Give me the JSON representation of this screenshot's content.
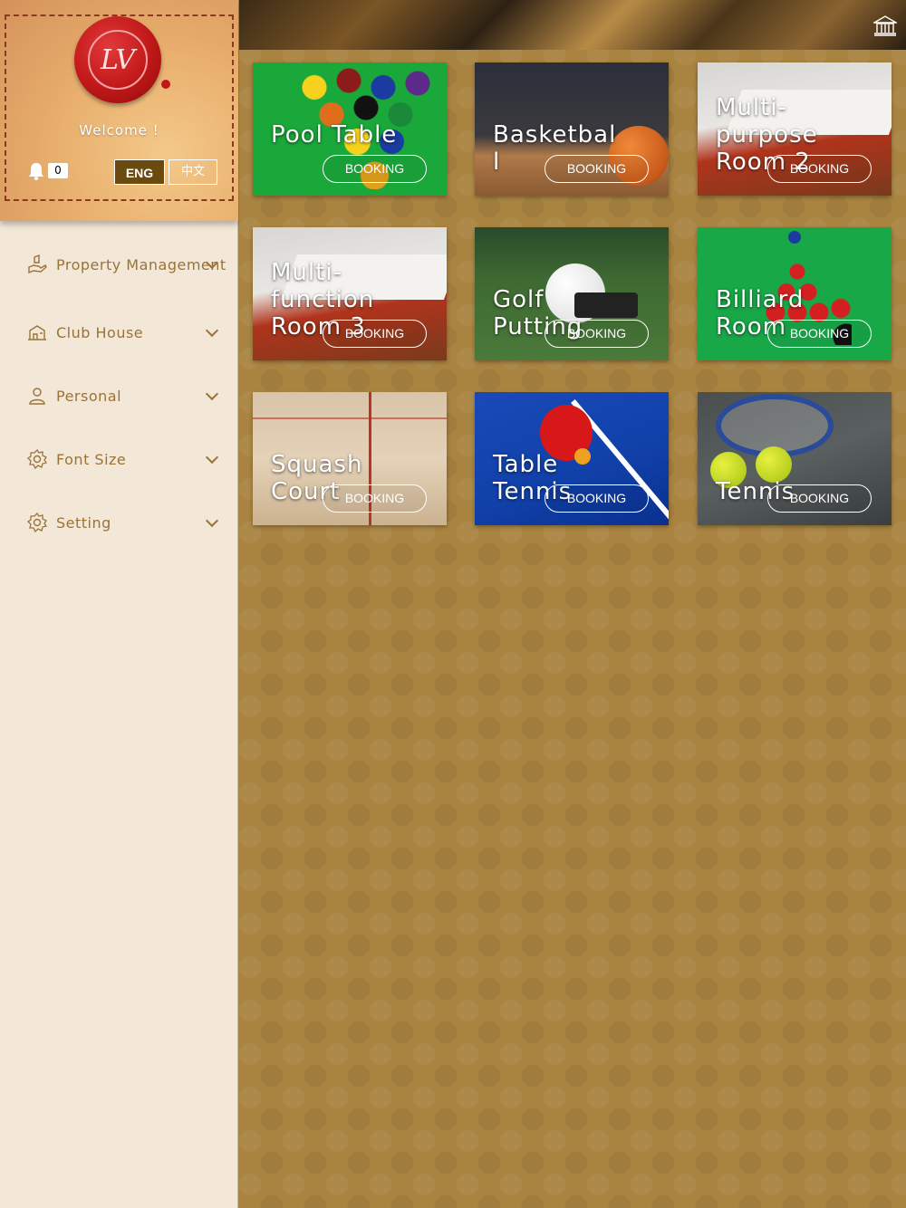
{
  "profile": {
    "seal_letters": "LV",
    "welcome": "Welcome !",
    "notification_count": "0",
    "lang_en": "ENG",
    "lang_zh": "中文"
  },
  "menu": [
    {
      "label": "Property Management",
      "icon": "hand-building-icon"
    },
    {
      "label": "Club House",
      "icon": "clubhouse-icon"
    },
    {
      "label": "Personal",
      "icon": "person-icon"
    },
    {
      "label": "Font Size",
      "icon": "gear-icon"
    },
    {
      "label": "Setting",
      "icon": "gear-icon"
    }
  ],
  "facilities": [
    {
      "title": "Pool Table",
      "booking": "BOOKING"
    },
    {
      "title": "Basketball",
      "booking": "BOOKING"
    },
    {
      "title": "Multi-purpose Room 2",
      "booking": "BOOKING"
    },
    {
      "title": "Multi-function Room 3",
      "booking": "BOOKING"
    },
    {
      "title": "Golf Putting",
      "booking": "BOOKING"
    },
    {
      "title": "Billiard Room",
      "booking": "BOOKING"
    },
    {
      "title": "Squash Court",
      "booking": "BOOKING"
    },
    {
      "title": "Table Tennis",
      "booking": "BOOKING"
    },
    {
      "title": "Tennis",
      "booking": "BOOKING"
    }
  ],
  "colors": {
    "sidebar_bg": "#f3e7d7",
    "menu_text": "#9a7339",
    "main_bg": "#a98340",
    "lang_active": "#6b4a10"
  }
}
